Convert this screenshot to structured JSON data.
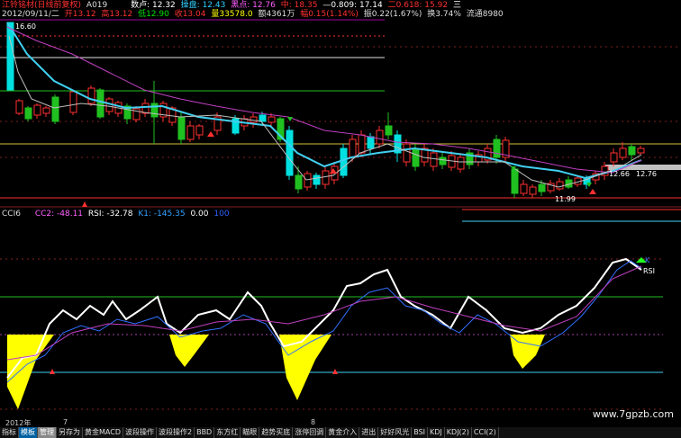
{
  "stock": {
    "name": "江铃铭材(日线前复权)",
    "code": "A019",
    "date_line": "2012/09/11/二",
    "open": "开13.12",
    "high": "高13.12",
    "low": "低12.90",
    "close": "收13.04",
    "volume": "量33578.0",
    "amount": "额4361万",
    "change": "幅0.15(1.14%)",
    "amplitude": "振0.22(1.67%)",
    "turnover": "换3.74%",
    "float": "流通8980",
    "buy_label": "数卢: 12.32",
    "opslabel": "操盘: 12.43",
    "short_label": "黑点: 12.76",
    "mid_label": "中: 18.35",
    "ratio1": "—0.809: 17.14",
    "ratio2": "二0.618: 15.92",
    "ratio3": "三"
  },
  "price_labels": {
    "top": "16.60",
    "right_a": "12.66",
    "right_b": "12.76",
    "bottom": "11.99"
  },
  "indicator": {
    "name": "CCI6",
    "cc2": "CC2: -48.11",
    "rsi": "RSI: -32.78",
    "k1": "K1: -145.35",
    "val1": "0.00",
    "val2": "100",
    "k_tag": "K",
    "rsi_tag": "RSI"
  },
  "axis": {
    "year": "2012年",
    "month7": "7",
    "month8": "8"
  },
  "watermark": "www.7gpzb.com",
  "tabs": [
    "指标",
    "模板",
    "管理",
    "另存为",
    "黄金MACD",
    "波段操作",
    "波段操作2",
    "BBD",
    "东方红",
    "瞄眼",
    "趋势买底",
    "涨停回调",
    "黄金介入",
    "进出",
    "好好风光",
    "BSI",
    "KDJ",
    "KDJ(2)",
    "CCI(2)"
  ],
  "active_tab": "管理",
  "colors": {
    "up": "#ff3030",
    "down": "#00e0e0",
    "ma_cyan": "#40d0f0",
    "ma_pink": "#c040c0",
    "gold": "#d0c040",
    "yellow": "#ffff00"
  }
}
